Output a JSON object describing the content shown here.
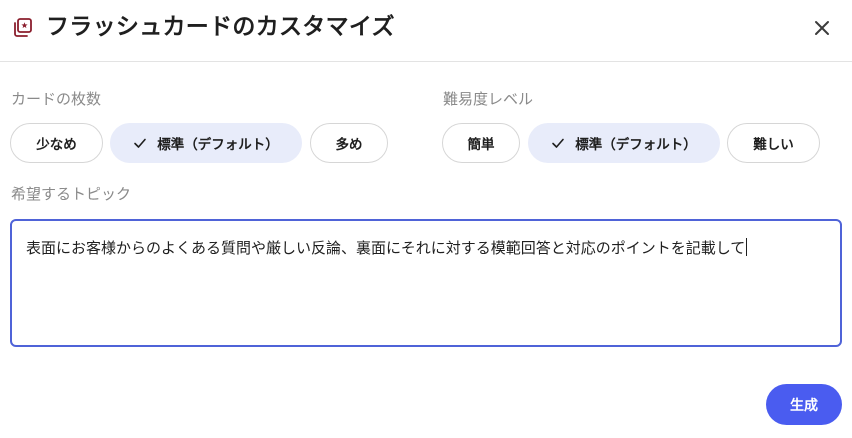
{
  "header": {
    "icon": "flashcard-icon",
    "title": "フラッシュカードのカスタマイズ",
    "close_icon": "close-icon"
  },
  "card_count": {
    "label": "カードの枚数",
    "options": [
      "少なめ",
      "標準（デフォルト）",
      "多め"
    ],
    "selected": "標準（デフォルト）"
  },
  "difficulty": {
    "label": "難易度レベル",
    "options": [
      "簡単",
      "標準（デフォルト）",
      "難しい"
    ],
    "selected": "標準（デフォルト）"
  },
  "topic": {
    "label": "希望するトピック",
    "value": "表面にお客様からのよくある質問や厳しい反論、裏面にそれに対する模範回答と対応のポイントを記載して"
  },
  "generate_label": "生成",
  "colors": {
    "accent": "#4a5cf0",
    "selected_chip": "#e8ecfa",
    "brand_icon": "#8b1e2d"
  }
}
